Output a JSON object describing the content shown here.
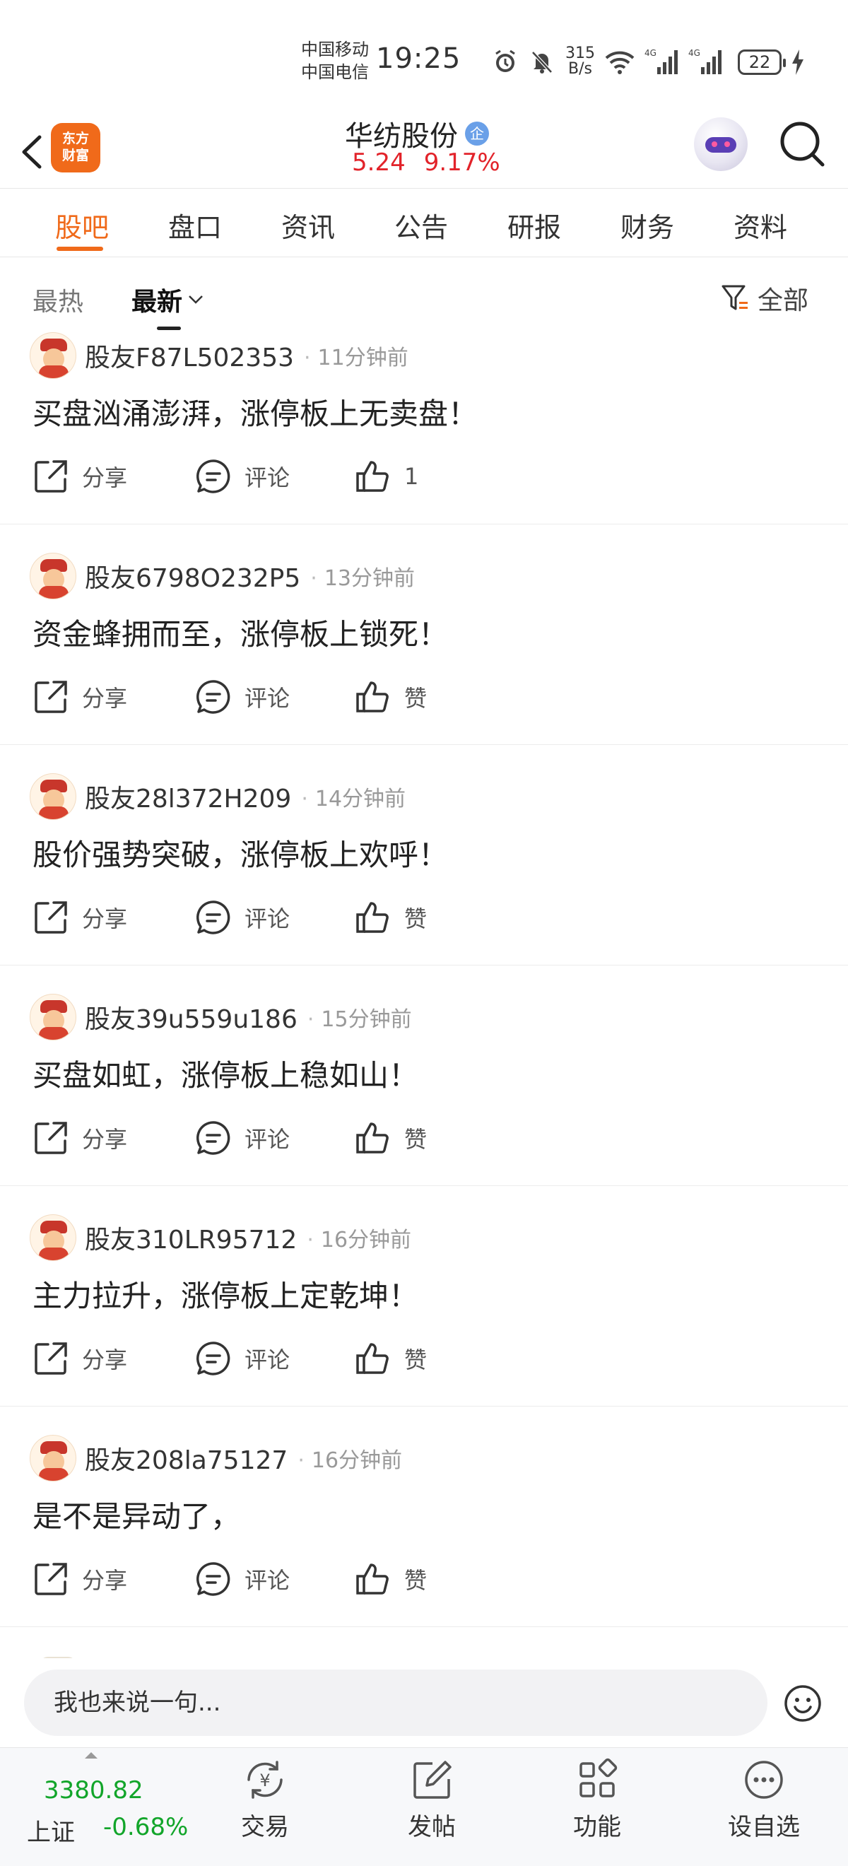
{
  "status_bar": {
    "carrier1": "中国移动",
    "carrier2": "中国电信",
    "time": "19:25",
    "net_speed_value": "315",
    "net_speed_unit": "B/s",
    "battery": "22"
  },
  "header": {
    "logo_line1": "东方",
    "logo_line2": "财富",
    "stock_name": "华纺股份",
    "badge": "企",
    "price": "5.24",
    "change_pct": "9.17%"
  },
  "tabs": [
    {
      "label": "股吧"
    },
    {
      "label": "盘口"
    },
    {
      "label": "资讯"
    },
    {
      "label": "公告"
    },
    {
      "label": "研报"
    },
    {
      "label": "财务"
    },
    {
      "label": "资料"
    }
  ],
  "sort": {
    "hot": "最热",
    "newest": "最新",
    "filter": "全部"
  },
  "action_labels": {
    "share": "分享",
    "comment": "评论"
  },
  "posts": [
    {
      "user": "股友F87L502353",
      "time": "11分钟前",
      "text": "买盘汹涌澎湃，涨停板上无卖盘！",
      "likes": "1"
    },
    {
      "user": "股友6798O232P5",
      "time": "13分钟前",
      "text": "资金蜂拥而至，涨停板上锁死！",
      "likes": "赞"
    },
    {
      "user": "股友28l372H209",
      "time": "14分钟前",
      "text": "股价强势突破，涨停板上欢呼！",
      "likes": "赞"
    },
    {
      "user": "股友39u559u186",
      "time": "15分钟前",
      "text": "买盘如虹，涨停板上稳如山！",
      "likes": "赞"
    },
    {
      "user": "股友310LR95712",
      "time": "16分钟前",
      "text": "主力拉升，涨停板上定乾坤！",
      "likes": "赞"
    },
    {
      "user": "股友208la75127",
      "time": "16分钟前",
      "text": "是不是异动了，",
      "likes": "赞"
    }
  ],
  "comment_bar": {
    "placeholder": "我也来说一句..."
  },
  "bottom_nav": {
    "index_value": "3380.82",
    "index_name": "上证",
    "index_change": "-0.68%",
    "items": [
      {
        "label": "交易",
        "icon": "yen-cycle-icon"
      },
      {
        "label": "发帖",
        "icon": "edit-icon"
      },
      {
        "label": "功能",
        "icon": "grid-icon"
      },
      {
        "label": "设自选",
        "icon": "more-icon"
      }
    ]
  },
  "colors": {
    "accent": "#f06a1a",
    "price_up": "#e2232a",
    "index_down": "#12a52a"
  }
}
